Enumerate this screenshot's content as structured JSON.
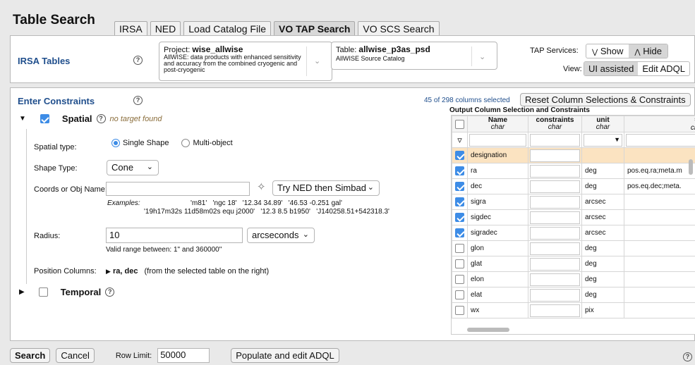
{
  "header": {
    "title": "Table Search",
    "tabs": [
      {
        "label": "IRSA"
      },
      {
        "label": "NED"
      },
      {
        "label": "Load Catalog File"
      },
      {
        "label": "VO TAP Search"
      },
      {
        "label": "VO SCS Search"
      }
    ]
  },
  "topbar": {
    "section_title": "IRSA Tables",
    "project_prefix": "Project:",
    "project_name": "wise_allwise",
    "project_desc": "AllWISE: data products with enhanced sensitivity and accuracy from the combined cryogenic and post-cryogenic",
    "table_prefix": "Table:",
    "table_name": "allwise_p3as_psd",
    "table_desc": "AllWISE Source Catalog",
    "tap_services_label": "TAP Services:",
    "show_label": "Show",
    "hide_label": "Hide",
    "view_label": "View:",
    "ui_assisted_label": "UI assisted",
    "edit_adql_label": "Edit ADQL"
  },
  "constraints": {
    "title": "Enter Constraints",
    "spatial_label": "Spatial",
    "no_target": "no target found",
    "spatial_type_label": "Spatial type:",
    "single_shape": "Single Shape",
    "multi_object": "Multi-object",
    "shape_type_label": "Shape Type:",
    "shape_value": "Cone",
    "coords_label": "Coords or Obj Name:",
    "resolver": "Try NED then Simbad",
    "examples_label": "Examples:",
    "examples_line1": "'m81'   'ngc 18'   '12.34 34.89'   '46.53 -0.251 gal'",
    "examples_line2": "'19h17m32s 11d58m02s equ j2000'   '12.3 8.5 b1950'   'J140258.51+542318.3'",
    "radius_label": "Radius:",
    "radius_value": "10",
    "radius_unit": "arcseconds",
    "radius_range": "Valid range between: 1\" and 360000\"",
    "position_label": "Position Columns:",
    "position_value": "ra, dec",
    "position_note": "(from the selected table on the right)",
    "temporal_label": "Temporal"
  },
  "columns": {
    "selected_count": "45 of 298 columns selected",
    "reset_label": "Reset Column Selections & Constraints",
    "section_title": "Output Column Selection and Constraints",
    "headers": [
      {
        "name": "Name",
        "type": "char"
      },
      {
        "name": "constraints",
        "type": "char"
      },
      {
        "name": "unit",
        "type": "char"
      },
      {
        "name": "",
        "type": "cha"
      }
    ],
    "rows": [
      {
        "name": "designation",
        "unit": "",
        "ucd": "",
        "checked": true,
        "highlight": true
      },
      {
        "name": "ra",
        "unit": "deg",
        "ucd": "pos.eq.ra;meta.m",
        "checked": true
      },
      {
        "name": "dec",
        "unit": "deg",
        "ucd": "pos.eq.dec;meta.",
        "checked": true
      },
      {
        "name": "sigra",
        "unit": "arcsec",
        "ucd": "",
        "checked": true
      },
      {
        "name": "sigdec",
        "unit": "arcsec",
        "ucd": "",
        "checked": true
      },
      {
        "name": "sigradec",
        "unit": "arcsec",
        "ucd": "",
        "checked": true
      },
      {
        "name": "glon",
        "unit": "deg",
        "ucd": "",
        "checked": false
      },
      {
        "name": "glat",
        "unit": "deg",
        "ucd": "",
        "checked": false
      },
      {
        "name": "elon",
        "unit": "deg",
        "ucd": "",
        "checked": false
      },
      {
        "name": "elat",
        "unit": "deg",
        "ucd": "",
        "checked": false
      },
      {
        "name": "wx",
        "unit": "pix",
        "ucd": "",
        "checked": false
      }
    ]
  },
  "bottom": {
    "search_label": "Search",
    "cancel_label": "Cancel",
    "row_limit_label": "Row Limit:",
    "row_limit_value": "50000",
    "populate_label": "Populate and edit ADQL"
  }
}
